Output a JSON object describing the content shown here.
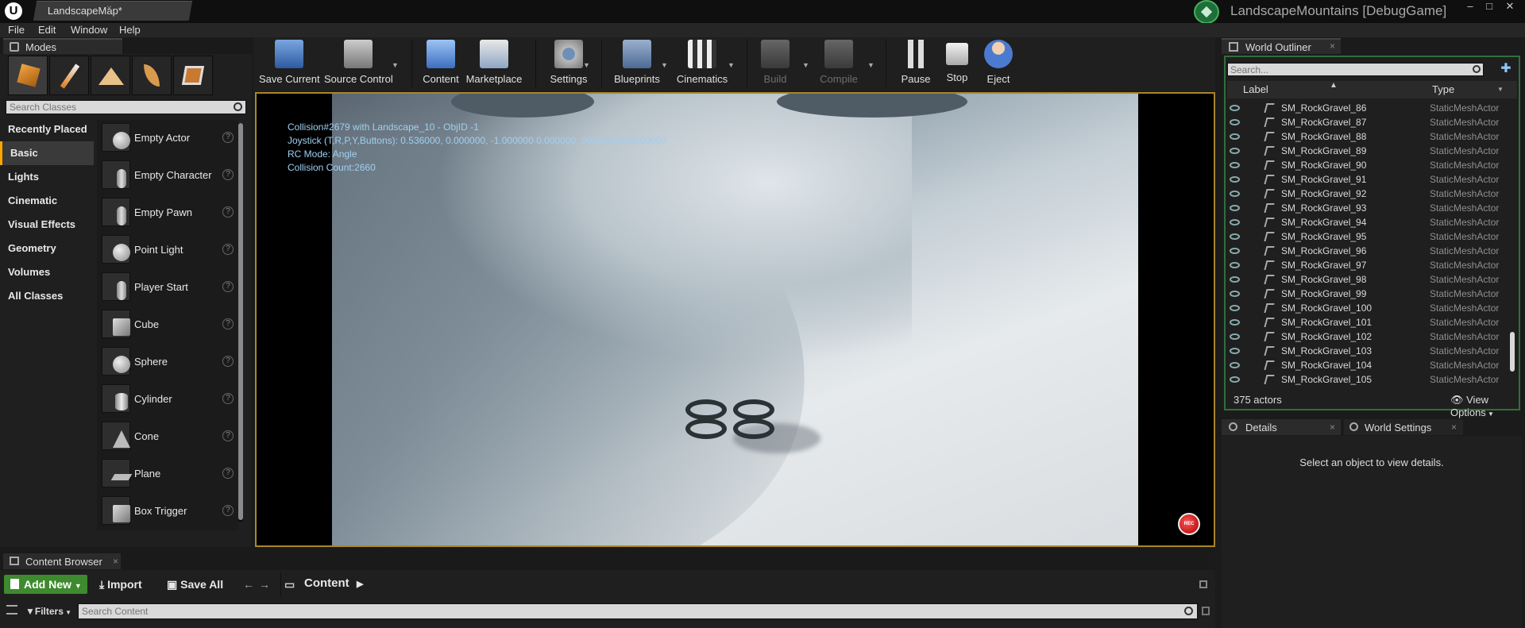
{
  "window": {
    "logo": "U",
    "doc_tab": "LandscapeMap*",
    "project_title": "LandscapeMountains [DebugGame]",
    "controls": {
      "minimize": "–",
      "maximize": "□",
      "close": "✕"
    }
  },
  "menu": [
    "File",
    "Edit",
    "Window",
    "Help"
  ],
  "modes": {
    "tab_label": "Modes",
    "close": "×",
    "search_placeholder": "Search Classes",
    "categories": [
      "Recently Placed",
      "Basic",
      "Lights",
      "Cinematic",
      "Visual Effects",
      "Geometry",
      "Volumes",
      "All Classes"
    ],
    "active_category": "Basic",
    "items": [
      "Empty Actor",
      "Empty Character",
      "Empty Pawn",
      "Point Light",
      "Player Start",
      "Cube",
      "Sphere",
      "Cylinder",
      "Cone",
      "Plane",
      "Box Trigger"
    ],
    "help_glyph": "?"
  },
  "toolbar": {
    "buttons": [
      "Save Current",
      "Source Control",
      "Content",
      "Marketplace",
      "Settings",
      "Blueprints",
      "Cinematics",
      "Build",
      "Compile",
      "Pause",
      "Stop",
      "Eject"
    ],
    "disabled": [
      "Build",
      "Compile"
    ]
  },
  "viewport": {
    "hud": [
      "Collision#2679 with Landscape_10 - ObjID -1",
      "Joystick (T,R,P,Y,Buttons): 0.536000, 0.000000, -1.000000 0.000000, 0000000000000000",
      "RC Mode: Angle",
      "Collision Count:2660"
    ],
    "record_label": "REC"
  },
  "content_browser": {
    "tab_label": "Content Browser",
    "close": "×",
    "add_new": "Add New",
    "import": "Import",
    "save_all": "Save All",
    "path": "Content",
    "filters": "Filters",
    "search_placeholder": "Search Content"
  },
  "world_outliner": {
    "tab_label": "World Outliner",
    "close": "×",
    "search_placeholder": "Search...",
    "col_label": "Label",
    "col_type": "Type",
    "rows": [
      {
        "name": "SM_RockGravel_86",
        "type": "StaticMeshActor"
      },
      {
        "name": "SM_RockGravel_87",
        "type": "StaticMeshActor"
      },
      {
        "name": "SM_RockGravel_88",
        "type": "StaticMeshActor"
      },
      {
        "name": "SM_RockGravel_89",
        "type": "StaticMeshActor"
      },
      {
        "name": "SM_RockGravel_90",
        "type": "StaticMeshActor"
      },
      {
        "name": "SM_RockGravel_91",
        "type": "StaticMeshActor"
      },
      {
        "name": "SM_RockGravel_92",
        "type": "StaticMeshActor"
      },
      {
        "name": "SM_RockGravel_93",
        "type": "StaticMeshActor"
      },
      {
        "name": "SM_RockGravel_94",
        "type": "StaticMeshActor"
      },
      {
        "name": "SM_RockGravel_95",
        "type": "StaticMeshActor"
      },
      {
        "name": "SM_RockGravel_96",
        "type": "StaticMeshActor"
      },
      {
        "name": "SM_RockGravel_97",
        "type": "StaticMeshActor"
      },
      {
        "name": "SM_RockGravel_98",
        "type": "StaticMeshActor"
      },
      {
        "name": "SM_RockGravel_99",
        "type": "StaticMeshActor"
      },
      {
        "name": "SM_RockGravel_100",
        "type": "StaticMeshActor"
      },
      {
        "name": "SM_RockGravel_101",
        "type": "StaticMeshActor"
      },
      {
        "name": "SM_RockGravel_102",
        "type": "StaticMeshActor"
      },
      {
        "name": "SM_RockGravel_103",
        "type": "StaticMeshActor"
      },
      {
        "name": "SM_RockGravel_104",
        "type": "StaticMeshActor"
      },
      {
        "name": "SM_RockGravel_105",
        "type": "StaticMeshActor"
      }
    ],
    "count": "375 actors",
    "view_options": "View Options"
  },
  "details": {
    "tab_label": "Details",
    "world_settings_label": "World Settings",
    "close": "×",
    "empty_message": "Select an object to view details."
  },
  "colors": {
    "accent_green": "#3e8a2e",
    "viewport_border": "#a8872b",
    "hud_text": "#9fd0f0"
  }
}
